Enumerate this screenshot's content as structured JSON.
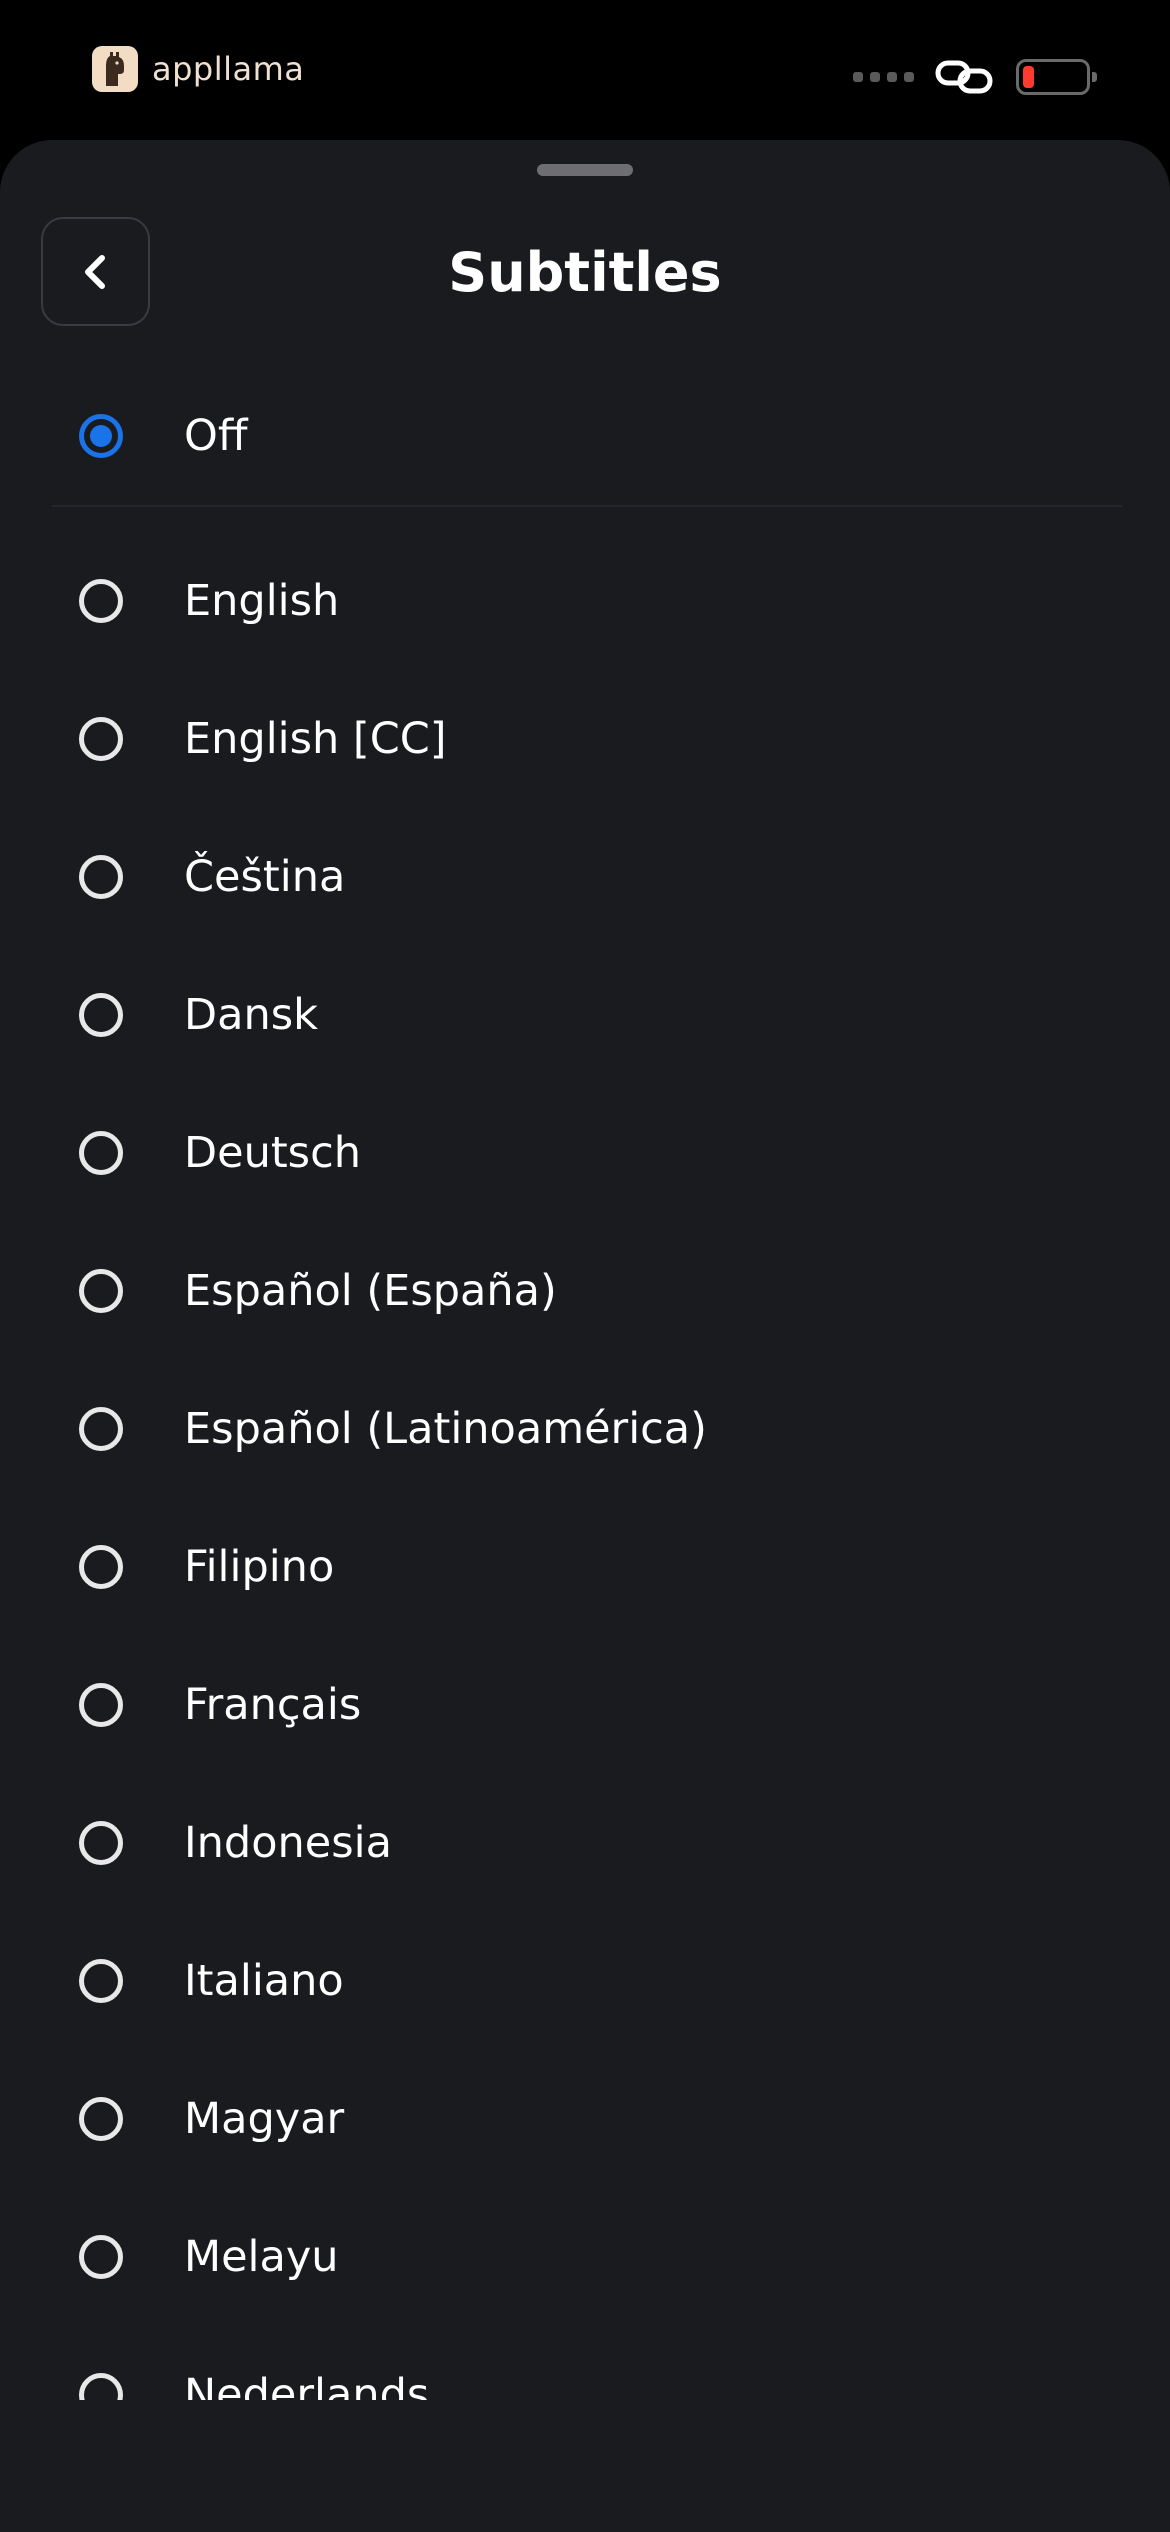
{
  "status_bar": {
    "brand_name": "appllama",
    "battery_level": 0.18,
    "battery_color": "#ff3b30"
  },
  "sheet": {
    "title": "Subtitles",
    "back_icon": "chevron-left-icon",
    "accent_color": "#1a73e8",
    "selected_option": "Off",
    "off_option": {
      "label": "Off",
      "selected": true
    },
    "languages": [
      {
        "label": "English",
        "selected": false
      },
      {
        "label": "English [CC]",
        "selected": false
      },
      {
        "label": "Čeština",
        "selected": false
      },
      {
        "label": "Dansk",
        "selected": false
      },
      {
        "label": "Deutsch",
        "selected": false
      },
      {
        "label": "Español (España)",
        "selected": false
      },
      {
        "label": "Español (Latinoamérica)",
        "selected": false
      },
      {
        "label": "Filipino",
        "selected": false
      },
      {
        "label": "Français",
        "selected": false
      },
      {
        "label": "Indonesia",
        "selected": false
      },
      {
        "label": "Italiano",
        "selected": false
      },
      {
        "label": "Magyar",
        "selected": false
      },
      {
        "label": "Melayu",
        "selected": false
      },
      {
        "label": "Nederlands",
        "selected": false
      }
    ]
  }
}
